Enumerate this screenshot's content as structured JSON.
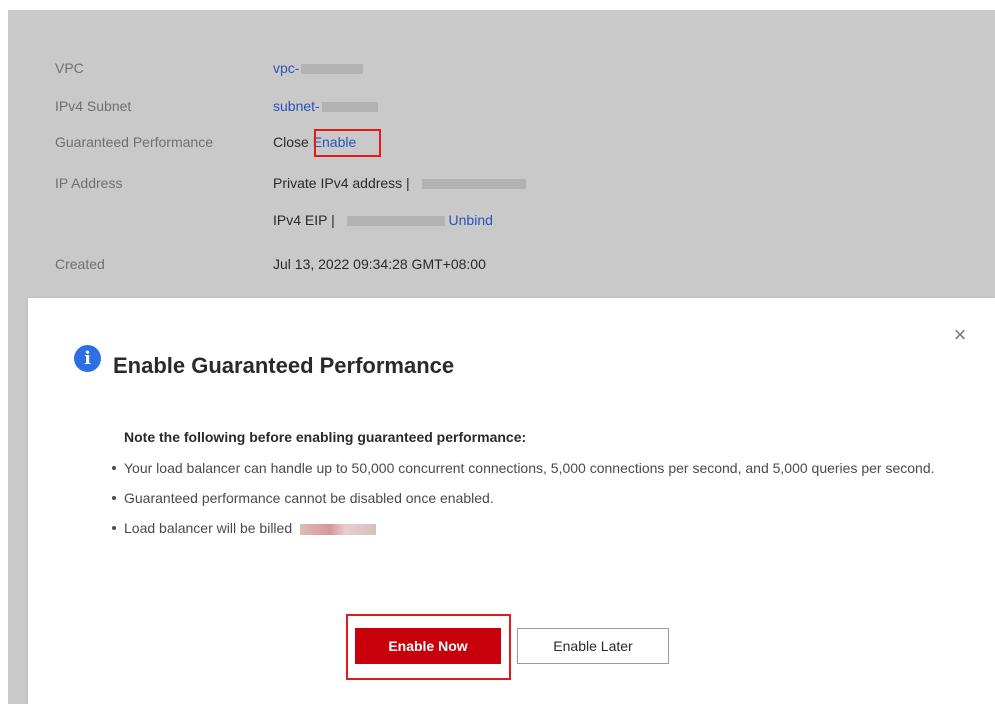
{
  "background": {
    "rows": [
      {
        "label": "VPC",
        "value_link": "vpc-"
      },
      {
        "label": "IPv4 Subnet",
        "value_link": "subnet-"
      },
      {
        "label": "Guaranteed Performance",
        "value": "Close",
        "link": "Enable"
      },
      {
        "label": "IP Address",
        "value": "Private IPv4 address |"
      },
      {
        "label": "",
        "value": "IPv4 EIP |",
        "link": "Unbind"
      },
      {
        "label": "Created",
        "value": "Jul 13, 2022 09:34:28 GMT+08:00"
      }
    ]
  },
  "dialog": {
    "title": "Enable Guaranteed Performance",
    "note_title": "Note the following before enabling guaranteed performance:",
    "bullets": [
      "Your load balancer can handle up to 50,000 concurrent connections, 5,000 connections per second, and 5,000 queries per second.",
      "Guaranteed performance cannot be disabled once enabled.",
      "Load balancer will be billed"
    ],
    "primary_button": "Enable Now",
    "secondary_button": "Enable Later",
    "close_glyph": "×",
    "info_glyph": "i"
  },
  "colors": {
    "accent_red": "#c7000b",
    "highlight_red": "#e21a1a",
    "link_blue": "#2b52b8",
    "info_blue": "#2f6fe4"
  }
}
